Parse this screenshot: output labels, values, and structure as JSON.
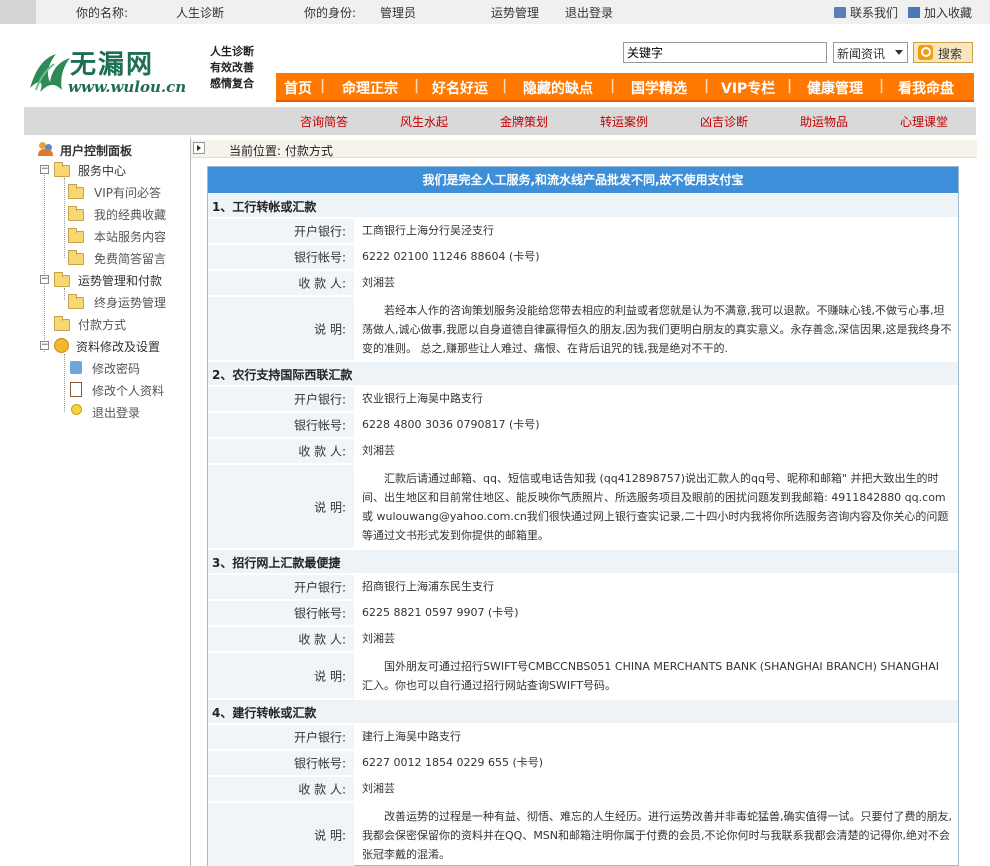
{
  "topbar": {
    "name_label": "你的名称:",
    "name_value": "人生诊断",
    "role_label": "你的身份:",
    "role_value": "管理员",
    "fortune_link": "运势管理",
    "logout_link": "退出登录",
    "contact_link": "联系我们",
    "favorite_link": "加入收藏"
  },
  "logo": {
    "cn": "无漏网",
    "en": "www.wulou.cn"
  },
  "slogan": [
    "人生诊断",
    "有效改善",
    "感情复合"
  ],
  "search": {
    "value": "关键字",
    "category": "新闻资讯",
    "button": "搜索"
  },
  "nav": [
    "首页",
    "命理正宗",
    "好名好运",
    "隐藏的缺点",
    "国学精选",
    "VIP专栏",
    "健康管理",
    "看我命盘"
  ],
  "subnav": [
    "咨询简答",
    "风生水起",
    "金牌策划",
    "转运案例",
    "凶吉诊断",
    "助运物品",
    "心理课堂"
  ],
  "sidebar": {
    "title": "用户控制面板",
    "groups": [
      {
        "label": "服务中心",
        "items": [
          "VIP有问必答",
          "我的经典收藏",
          "本站服务内容",
          "免费简答留言"
        ]
      },
      {
        "label": "运势管理和付款",
        "items": [
          "终身运势管理"
        ]
      },
      {
        "label": "付款方式",
        "items": []
      },
      {
        "label": "资料修改及设置",
        "items": [
          "修改密码",
          "修改个人资料",
          "退出登录"
        ]
      }
    ]
  },
  "breadcrumb": "当前位置: 付款方式",
  "panel_title": "我们是完全人工服务,和流水线产品批发不同,故不使用支付宝",
  "sections": [
    {
      "title": "1、工行转帐或汇款",
      "bank_label": "开户银行:",
      "bank": "工商银行上海分行吴泾支行",
      "account_label": "银行帐号:",
      "account": "6222 02100 11246 88604 (卡号)",
      "payee_label": "收 款 人:",
      "payee": "刘湘芸",
      "note_label": "说 明:",
      "note": "若经本人作的咨询策划服务没能给您带去相应的利益或者您就是认为不满意,我可以退款。不赚昧心钱,不做亏心事,坦荡做人,诚心做事,我愿以自身道德自律赢得恒久的朋友,因为我们更明白朋友的真实意义。永存善念,深信因果,这是我终身不变的准则。 总之,赚那些让人难过、痛恨、在背后诅咒的钱,我是绝对不干的."
    },
    {
      "title": "2、农行支持国际西联汇款",
      "bank_label": "开户银行:",
      "bank": "农业银行上海吴中路支行",
      "account_label": "银行帐号:",
      "account": "6228 4800 3036 0790817 (卡号)",
      "payee_label": "收 款 人:",
      "payee": "刘湘芸",
      "note_label": "说 明:",
      "note": "汇款后请通过邮箱、qq、短信或电话告知我 (qq412898757)说出汇款人的qq号、昵称和邮箱\" 并把大致出生的时间、出生地区和目前常住地区、能反映你气质照片、所选服务项目及眼前的困扰问题发到我邮箱: 4911842880 qq.com或 wulouwang@yahoo.com.cn我们很快通过网上银行查实记录,二十四小时内我将你所选服务咨询内容及你关心的问题等通过文书形式发到你提供的邮箱里。"
    },
    {
      "title": "3、招行网上汇款最便捷",
      "bank_label": "开户银行:",
      "bank": "招商银行上海浦东民生支行",
      "account_label": "银行帐号:",
      "account": "6225 8821 0597 9907 (卡号)",
      "payee_label": "收 款 人:",
      "payee": "刘湘芸",
      "note_label": "说 明:",
      "note": "国外朋友可通过招行SWIFT号CMBCCNBS051 CHINA MERCHANTS BANK (SHANGHAI BRANCH) SHANGHAI 汇入。你也可以自行通过招行网站查询SWIFT号码。"
    },
    {
      "title": "4、建行转帐或汇款",
      "bank_label": "开户银行:",
      "bank": "建行上海吴中路支行",
      "account_label": "银行帐号:",
      "account": "6227 0012 1854 0229 655 (卡号)",
      "payee_label": "收 款 人:",
      "payee": "刘湘芸",
      "note_label": "说 明:",
      "note": "改善运势的过程是一种有益、彻悟、难忘的人生经历。进行运势改善并非毒蛇猛兽,确实值得一试。只要付了费的朋友,我都会保密保留你的资料并在QQ、MSN和邮箱注明你属于付费的会员,不论你何时与我联系我都会清楚的记得你,绝对不会张冠李戴的混淆。"
    }
  ],
  "colors": {
    "nav_orange": "#ff7800",
    "panel_header_blue": "#3e8fd9",
    "accent_red": "#cc0000",
    "logo_green": "#1e6f52"
  }
}
